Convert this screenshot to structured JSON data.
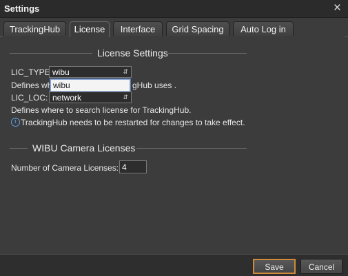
{
  "window": {
    "title": "Settings",
    "close_glyph": "×"
  },
  "tabs": [
    {
      "label": "TrackingHub",
      "active": false
    },
    {
      "label": "License",
      "active": true
    },
    {
      "label": "Interface",
      "active": false
    },
    {
      "label": "Grid Spacing",
      "active": false
    },
    {
      "label": "Auto Log in",
      "active": false
    }
  ],
  "license_settings": {
    "section_title": "License Settings",
    "lic_type_label": "LIC_TYPE:",
    "lic_type_value": "wibu",
    "lic_type_dropdown_options": [
      "wibu"
    ],
    "lic_type_desc_start": "Defines wh",
    "lic_type_desc_end": "gHub uses .",
    "lic_loc_label": "LIC_LOC:",
    "lic_loc_value": "network",
    "lic_loc_desc": "Defines where to search license for TrackingHub.",
    "restart_note": "TrackingHub needs to be restarted for changes to take effect.",
    "info_glyph": "i"
  },
  "wibu_licenses": {
    "section_title": "WIBU Camera Licenses",
    "count_label": "Number of Camera Licenses:",
    "count_value": "4"
  },
  "footer": {
    "save_label": "Save",
    "cancel_label": "Cancel"
  },
  "colors": {
    "accent_focus": "#d08a3a",
    "info_blue": "#5aa0e6",
    "background": "#3c3c3c"
  }
}
